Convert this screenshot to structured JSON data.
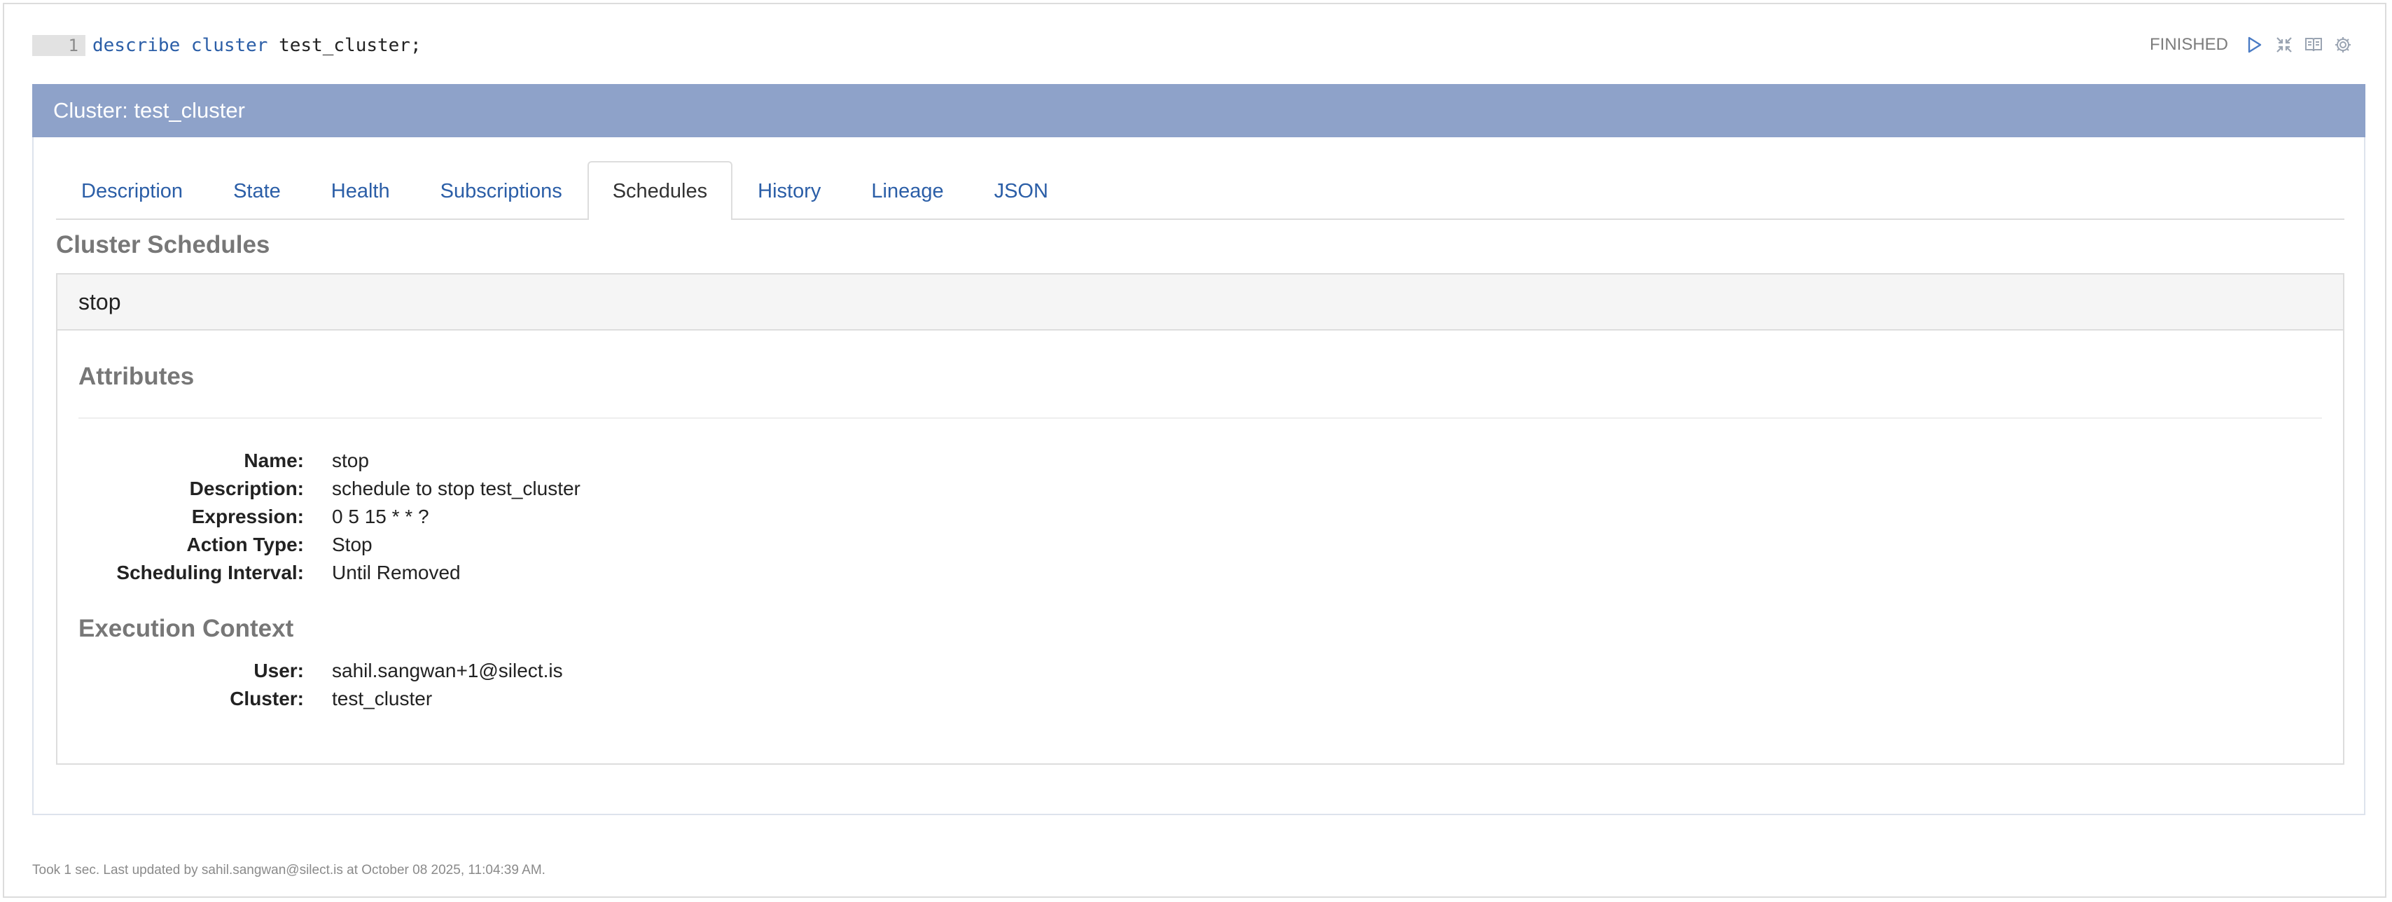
{
  "editor": {
    "line_number": "1",
    "code_keyword_1": "describe",
    "code_keyword_2": "cluster",
    "code_rest": "test_cluster;"
  },
  "status": {
    "text": "FINISHED",
    "icons": [
      "run-icon",
      "collapse-icon",
      "book-icon",
      "gear-icon"
    ]
  },
  "panel": {
    "title": "Cluster: test_cluster",
    "heading_color": "#8ea2c9"
  },
  "tabs": [
    {
      "label": "Description"
    },
    {
      "label": "State"
    },
    {
      "label": "Health"
    },
    {
      "label": "Subscriptions"
    },
    {
      "label": "Schedules",
      "active": true
    },
    {
      "label": "History"
    },
    {
      "label": "Lineage"
    },
    {
      "label": "JSON"
    }
  ],
  "schedules": {
    "section_title": "Cluster Schedules",
    "name": "stop",
    "attributes_title": "Attributes",
    "attributes": [
      {
        "key": "Name:",
        "value": "stop"
      },
      {
        "key": "Description:",
        "value": "schedule to stop test_cluster"
      },
      {
        "key": "Expression:",
        "value": "0 5 15 * * ?"
      },
      {
        "key": "Action Type:",
        "value": "Stop"
      },
      {
        "key": "Scheduling Interval:",
        "value": "Until Removed"
      }
    ],
    "execution_title": "Execution Context",
    "execution": [
      {
        "key": "User:",
        "value": "sahil.sangwan+1@silect.is"
      },
      {
        "key": "Cluster:",
        "value": "test_cluster"
      }
    ]
  },
  "footer": {
    "text": "Took 1 sec. Last updated by sahil.sangwan@silect.is at October 08 2025, 11:04:39 AM."
  }
}
